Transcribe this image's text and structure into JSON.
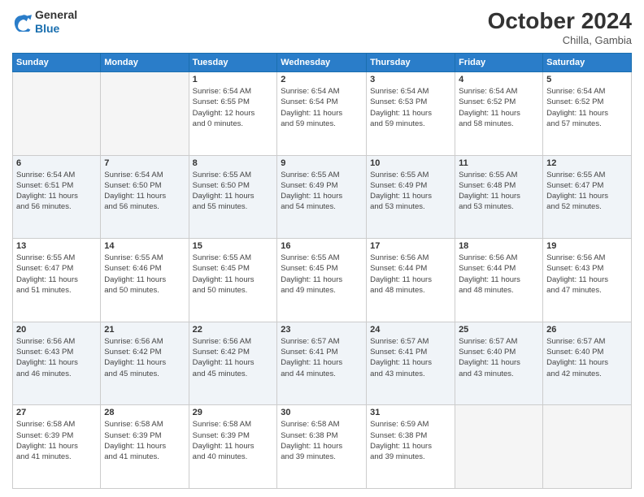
{
  "header": {
    "logo": {
      "general": "General",
      "blue": "Blue"
    },
    "title": "October 2024",
    "subtitle": "Chilla, Gambia"
  },
  "days_of_week": [
    "Sunday",
    "Monday",
    "Tuesday",
    "Wednesday",
    "Thursday",
    "Friday",
    "Saturday"
  ],
  "weeks": [
    [
      {
        "day": "",
        "info": ""
      },
      {
        "day": "",
        "info": ""
      },
      {
        "day": "1",
        "info": "Sunrise: 6:54 AM\nSunset: 6:55 PM\nDaylight: 12 hours\nand 0 minutes."
      },
      {
        "day": "2",
        "info": "Sunrise: 6:54 AM\nSunset: 6:54 PM\nDaylight: 11 hours\nand 59 minutes."
      },
      {
        "day": "3",
        "info": "Sunrise: 6:54 AM\nSunset: 6:53 PM\nDaylight: 11 hours\nand 59 minutes."
      },
      {
        "day": "4",
        "info": "Sunrise: 6:54 AM\nSunset: 6:52 PM\nDaylight: 11 hours\nand 58 minutes."
      },
      {
        "day": "5",
        "info": "Sunrise: 6:54 AM\nSunset: 6:52 PM\nDaylight: 11 hours\nand 57 minutes."
      }
    ],
    [
      {
        "day": "6",
        "info": "Sunrise: 6:54 AM\nSunset: 6:51 PM\nDaylight: 11 hours\nand 56 minutes."
      },
      {
        "day": "7",
        "info": "Sunrise: 6:54 AM\nSunset: 6:50 PM\nDaylight: 11 hours\nand 56 minutes."
      },
      {
        "day": "8",
        "info": "Sunrise: 6:55 AM\nSunset: 6:50 PM\nDaylight: 11 hours\nand 55 minutes."
      },
      {
        "day": "9",
        "info": "Sunrise: 6:55 AM\nSunset: 6:49 PM\nDaylight: 11 hours\nand 54 minutes."
      },
      {
        "day": "10",
        "info": "Sunrise: 6:55 AM\nSunset: 6:49 PM\nDaylight: 11 hours\nand 53 minutes."
      },
      {
        "day": "11",
        "info": "Sunrise: 6:55 AM\nSunset: 6:48 PM\nDaylight: 11 hours\nand 53 minutes."
      },
      {
        "day": "12",
        "info": "Sunrise: 6:55 AM\nSunset: 6:47 PM\nDaylight: 11 hours\nand 52 minutes."
      }
    ],
    [
      {
        "day": "13",
        "info": "Sunrise: 6:55 AM\nSunset: 6:47 PM\nDaylight: 11 hours\nand 51 minutes."
      },
      {
        "day": "14",
        "info": "Sunrise: 6:55 AM\nSunset: 6:46 PM\nDaylight: 11 hours\nand 50 minutes."
      },
      {
        "day": "15",
        "info": "Sunrise: 6:55 AM\nSunset: 6:45 PM\nDaylight: 11 hours\nand 50 minutes."
      },
      {
        "day": "16",
        "info": "Sunrise: 6:55 AM\nSunset: 6:45 PM\nDaylight: 11 hours\nand 49 minutes."
      },
      {
        "day": "17",
        "info": "Sunrise: 6:56 AM\nSunset: 6:44 PM\nDaylight: 11 hours\nand 48 minutes."
      },
      {
        "day": "18",
        "info": "Sunrise: 6:56 AM\nSunset: 6:44 PM\nDaylight: 11 hours\nand 48 minutes."
      },
      {
        "day": "19",
        "info": "Sunrise: 6:56 AM\nSunset: 6:43 PM\nDaylight: 11 hours\nand 47 minutes."
      }
    ],
    [
      {
        "day": "20",
        "info": "Sunrise: 6:56 AM\nSunset: 6:43 PM\nDaylight: 11 hours\nand 46 minutes."
      },
      {
        "day": "21",
        "info": "Sunrise: 6:56 AM\nSunset: 6:42 PM\nDaylight: 11 hours\nand 45 minutes."
      },
      {
        "day": "22",
        "info": "Sunrise: 6:56 AM\nSunset: 6:42 PM\nDaylight: 11 hours\nand 45 minutes."
      },
      {
        "day": "23",
        "info": "Sunrise: 6:57 AM\nSunset: 6:41 PM\nDaylight: 11 hours\nand 44 minutes."
      },
      {
        "day": "24",
        "info": "Sunrise: 6:57 AM\nSunset: 6:41 PM\nDaylight: 11 hours\nand 43 minutes."
      },
      {
        "day": "25",
        "info": "Sunrise: 6:57 AM\nSunset: 6:40 PM\nDaylight: 11 hours\nand 43 minutes."
      },
      {
        "day": "26",
        "info": "Sunrise: 6:57 AM\nSunset: 6:40 PM\nDaylight: 11 hours\nand 42 minutes."
      }
    ],
    [
      {
        "day": "27",
        "info": "Sunrise: 6:58 AM\nSunset: 6:39 PM\nDaylight: 11 hours\nand 41 minutes."
      },
      {
        "day": "28",
        "info": "Sunrise: 6:58 AM\nSunset: 6:39 PM\nDaylight: 11 hours\nand 41 minutes."
      },
      {
        "day": "29",
        "info": "Sunrise: 6:58 AM\nSunset: 6:39 PM\nDaylight: 11 hours\nand 40 minutes."
      },
      {
        "day": "30",
        "info": "Sunrise: 6:58 AM\nSunset: 6:38 PM\nDaylight: 11 hours\nand 39 minutes."
      },
      {
        "day": "31",
        "info": "Sunrise: 6:59 AM\nSunset: 6:38 PM\nDaylight: 11 hours\nand 39 minutes."
      },
      {
        "day": "",
        "info": ""
      },
      {
        "day": "",
        "info": ""
      }
    ]
  ]
}
